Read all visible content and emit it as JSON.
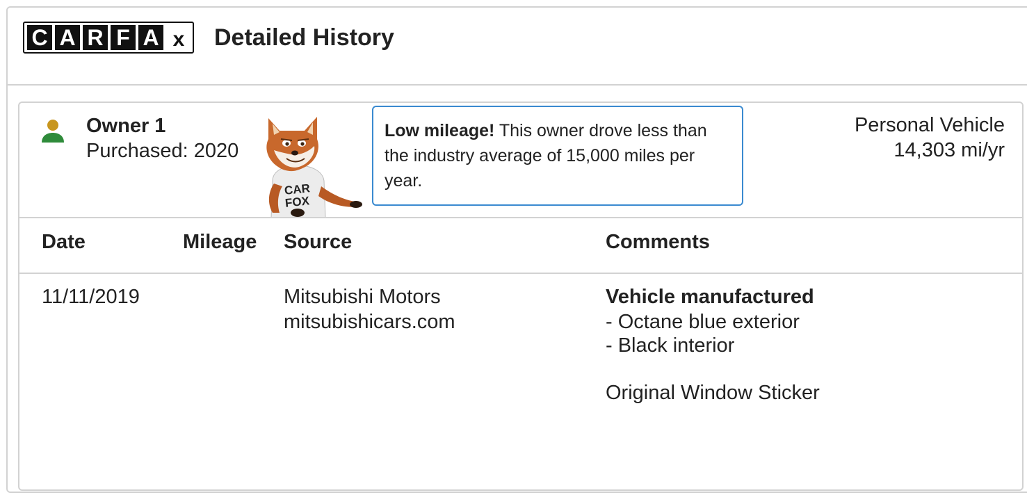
{
  "header": {
    "logo_letters": [
      "C",
      "A",
      "R",
      "F",
      "A"
    ],
    "logo_x": "x",
    "title": "Detailed History"
  },
  "owner": {
    "name": "Owner 1",
    "purchased": "Purchased: 2020",
    "icon": "person-icon",
    "icon_colors": {
      "head": "#c8961e",
      "body": "#2e8b3a"
    },
    "callout": {
      "bold": "Low mileage!",
      "text": " This owner drove less than the industry average of 15,000 miles per year."
    },
    "vehicle_type": "Personal Vehicle",
    "miles_per_year": "14,303 mi/yr",
    "mascot_shirt": [
      "CAR",
      "FOX"
    ]
  },
  "table": {
    "headers": [
      "Date",
      "Mileage",
      "Source",
      "Comments"
    ],
    "rows": [
      {
        "date": "11/11/2019",
        "mileage": "",
        "source_line1": "Mitsubishi Motors",
        "source_line2": "mitsubishicars.com",
        "comment_title": "Vehicle manufactured",
        "comment_items": [
          "Octane blue exterior",
          "Black interior"
        ],
        "comment_extra": "Original Window Sticker"
      }
    ]
  },
  "colors": {
    "border": "#d2d2d2",
    "callout_border": "#3a8ad0",
    "text": "#222222"
  }
}
